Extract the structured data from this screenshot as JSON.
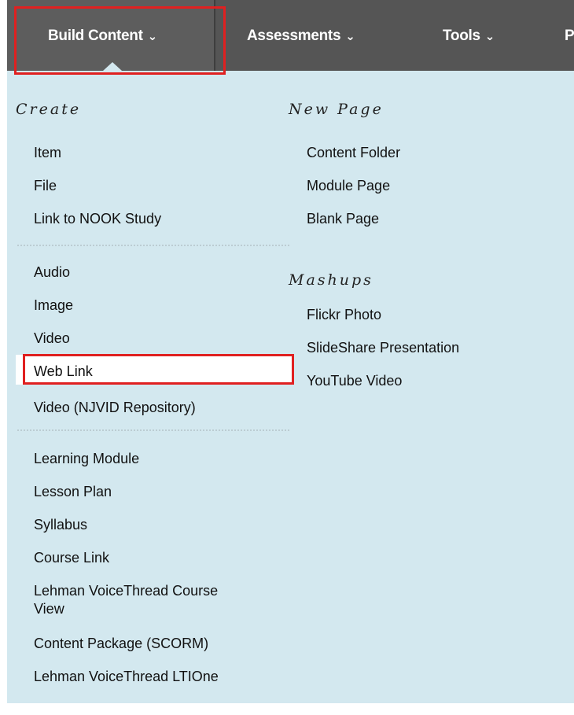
{
  "nav": {
    "tabs": [
      {
        "label": "Build Content"
      },
      {
        "label": "Assessments"
      },
      {
        "label": "Tools"
      },
      {
        "label": "P"
      }
    ]
  },
  "menu": {
    "create": {
      "heading": "Create",
      "group1": [
        "Item",
        "File",
        "Link to NOOK Study"
      ],
      "group2": [
        "Audio",
        "Image",
        "Video",
        "Web Link",
        "Video (NJVID Repository)"
      ],
      "group3": [
        "Learning Module",
        "Lesson Plan",
        "Syllabus",
        "Course Link",
        "Lehman VoiceThread Course",
        "View",
        "Content Package (SCORM)",
        "Lehman VoiceThread LTIOne"
      ]
    },
    "new_page": {
      "heading": "New Page",
      "items": [
        "Content Folder",
        "Module Page",
        "Blank Page"
      ]
    },
    "mashups": {
      "heading": "Mashups",
      "items": [
        "Flickr Photo",
        "SlideShare Presentation",
        "YouTube Video"
      ]
    }
  },
  "colors": {
    "nav_bg": "#555555",
    "menu_bg": "#d3e8ef",
    "highlight": "#e02020"
  },
  "icons": {
    "tab_caret": "chevron-down-icon"
  }
}
